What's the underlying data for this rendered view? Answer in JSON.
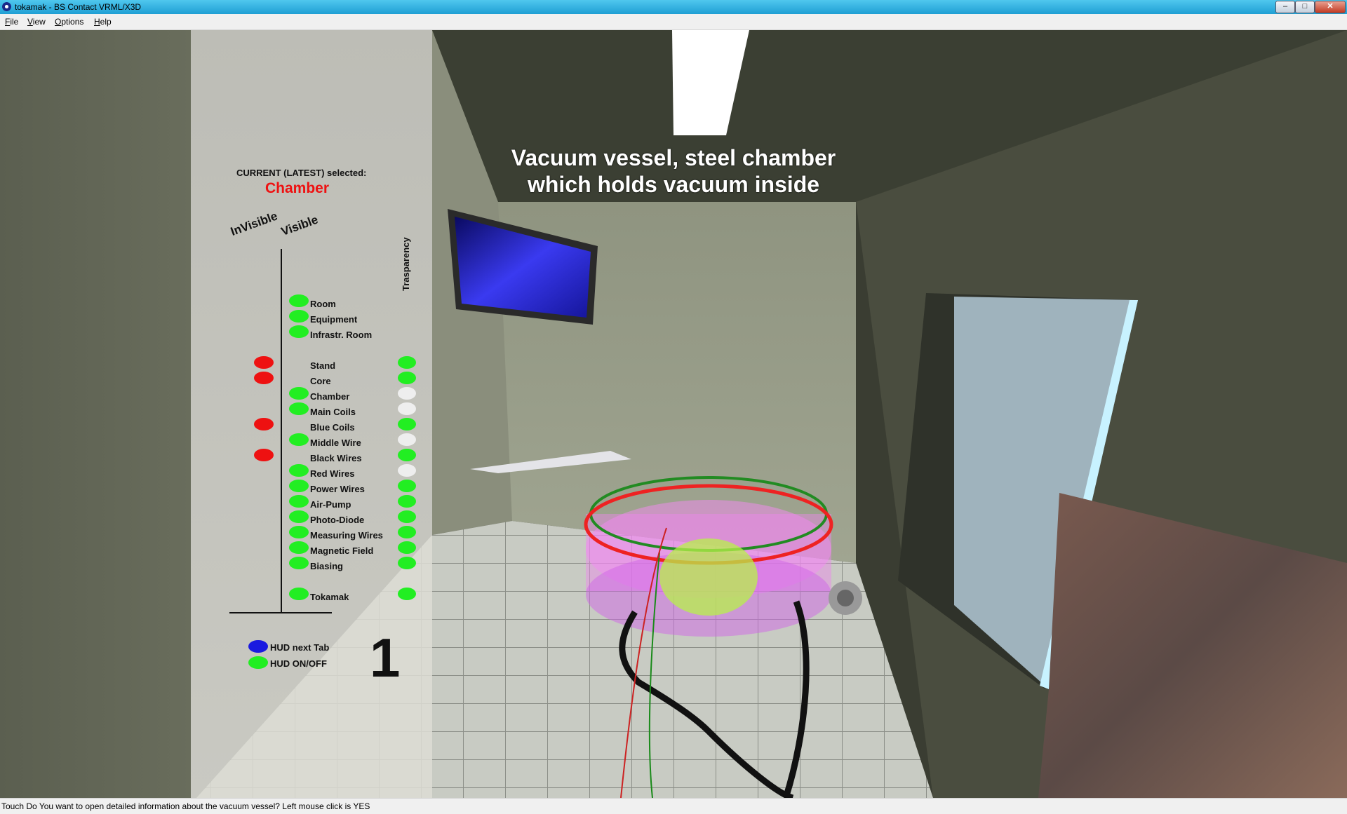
{
  "window": {
    "title": "tokamak - BS Contact VRML/X3D",
    "btn_min": "–",
    "btn_max": "□",
    "btn_close": "✕"
  },
  "menu": [
    {
      "accel": "F",
      "rest": "ile"
    },
    {
      "accel": "V",
      "rest": "iew"
    },
    {
      "accel": "O",
      "rest": "ptions"
    },
    {
      "accel": "H",
      "rest": "elp"
    }
  ],
  "hud": {
    "current_label": "CURRENT (LATEST) selected:",
    "current_value": "Chamber",
    "col_invisible": "InVisible",
    "col_visible": "Visible",
    "col_transparency": "Trasparency",
    "items": [
      {
        "label": "Room",
        "invisible": null,
        "visible": "green",
        "transparency": null
      },
      {
        "label": "Equipment",
        "invisible": null,
        "visible": "green",
        "transparency": null
      },
      {
        "label": "Infrastr. Room",
        "invisible": null,
        "visible": "green",
        "transparency": null
      },
      {
        "label": "Stand",
        "invisible": "red",
        "visible": null,
        "transparency": "green"
      },
      {
        "label": "Core",
        "invisible": "red",
        "visible": null,
        "transparency": "green"
      },
      {
        "label": "Chamber",
        "invisible": null,
        "visible": "green",
        "transparency": "white"
      },
      {
        "label": "Main Coils",
        "invisible": null,
        "visible": "green",
        "transparency": "white"
      },
      {
        "label": "Blue Coils",
        "invisible": "red",
        "visible": null,
        "transparency": "green"
      },
      {
        "label": "Middle Wire",
        "invisible": null,
        "visible": "green",
        "transparency": "white"
      },
      {
        "label": "Black Wires",
        "invisible": "red",
        "visible": null,
        "transparency": "green"
      },
      {
        "label": "Red Wires",
        "invisible": null,
        "visible": "green",
        "transparency": "white"
      },
      {
        "label": "Power Wires",
        "invisible": null,
        "visible": "green",
        "transparency": "green"
      },
      {
        "label": "Air-Pump",
        "invisible": null,
        "visible": "green",
        "transparency": "green"
      },
      {
        "label": "Photo-Diode",
        "invisible": null,
        "visible": "green",
        "transparency": "green"
      },
      {
        "label": "Measuring Wires",
        "invisible": null,
        "visible": "green",
        "transparency": "green"
      },
      {
        "label": "Magnetic Field",
        "invisible": null,
        "visible": "green",
        "transparency": "green"
      },
      {
        "label": "Biasing",
        "invisible": null,
        "visible": "green",
        "transparency": "green"
      },
      {
        "label": "Tokamak",
        "invisible": null,
        "visible": "green",
        "transparency": "green"
      }
    ],
    "hud_next_tab": "HUD next Tab",
    "hud_on_off": "HUD ON/OFF",
    "tab_number": "1"
  },
  "caption": {
    "line1": "Vacuum vessel, steel chamber",
    "line2": "which holds vacuum inside"
  },
  "status": "Touch Do You want to open detailed information about the vacuum vessel? Left mouse click is YES",
  "colors": {
    "green": "#22ee22",
    "red": "#ee1111",
    "white": "#eeeeee",
    "blue": "#1a1ae0",
    "selected": "#ee1111"
  }
}
